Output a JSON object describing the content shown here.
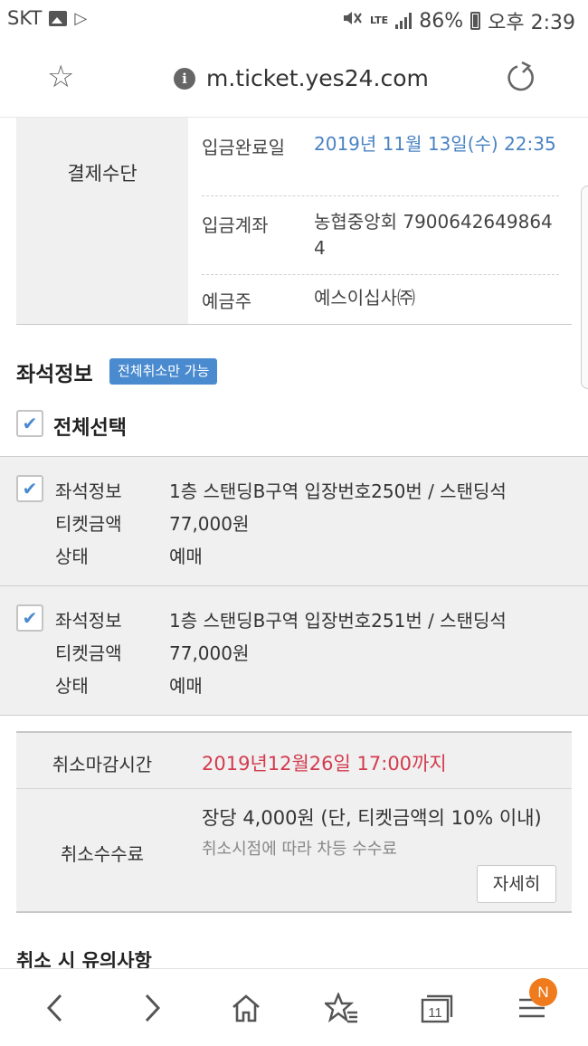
{
  "status_bar": {
    "carrier": "SKT",
    "lte": "LTE",
    "battery": "86%",
    "time": "오후 2:39"
  },
  "browser": {
    "url": "m.ticket.yes24.com"
  },
  "payment": {
    "section_label": "결제수단",
    "rows": [
      {
        "label": "입금완료일",
        "value": "2019년 11월 13일(수) 22:35"
      },
      {
        "label": "입금계좌",
        "value": "농협중앙회 79006426498644"
      },
      {
        "label": "예금주",
        "value": "예스이십사㈜"
      }
    ]
  },
  "seat_section": {
    "title": "좌석정보",
    "badge": "전체취소만 가능",
    "select_all_label": "전체선택",
    "items": [
      {
        "seat_label": "좌석정보",
        "seat_value": "1층 스탠딩B구역 입장번호250번 / 스탠딩석",
        "price_label": "티켓금액",
        "price_value": "77,000원",
        "status_label": "상태",
        "status_value": "예매",
        "checked": true
      },
      {
        "seat_label": "좌석정보",
        "seat_value": "1층 스탠딩B구역 입장번호251번 / 스탠딩석",
        "price_label": "티켓금액",
        "price_value": "77,000원",
        "status_label": "상태",
        "status_value": "예매",
        "checked": true
      }
    ]
  },
  "cancel": {
    "deadline_label": "취소마감시간",
    "deadline_value": "2019년12월26일 17:00까지",
    "fee_label": "취소수수료",
    "fee_value": "장당 4,000원 (단, 티켓금액의 10% 이내)",
    "fee_note": "취소시점에 따라 차등 수수료",
    "detail_button": "자세히"
  },
  "notice_title": "취소 시 유의사항",
  "bottom_nav": {
    "tab_count": "11",
    "badge": "N"
  },
  "colors": {
    "accent_blue": "#4a8bd0",
    "date_blue": "#4a83c2",
    "deadline_red": "#d33b4e",
    "badge_orange": "#f07b1c"
  }
}
